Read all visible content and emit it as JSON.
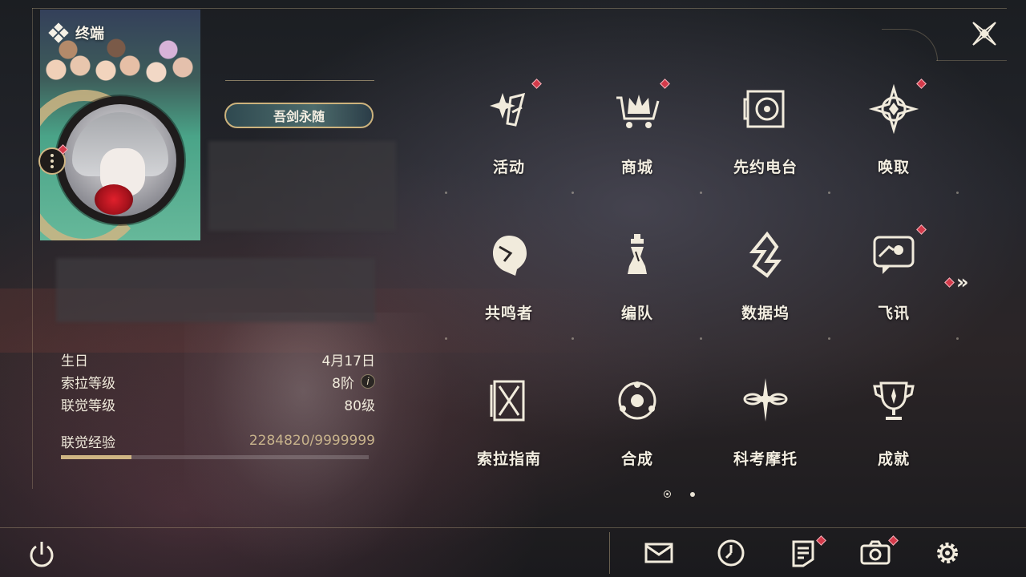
{
  "window": {
    "title": "终端"
  },
  "profile": {
    "title_badge": "吾剑永随"
  },
  "stats": [
    {
      "label": "生日",
      "value": "4月17日"
    },
    {
      "label": "索拉等级",
      "value": "8阶"
    },
    {
      "label": "联觉等级",
      "value": "80级"
    }
  ],
  "experience": {
    "label": "联觉经验",
    "value": "2284820/9999999",
    "progress": 0.2285
  },
  "menu": {
    "items": [
      {
        "label": "活动",
        "icon": "activity-icon",
        "has_notification": true
      },
      {
        "label": "商城",
        "icon": "shop-cart-icon",
        "has_notification": true
      },
      {
        "label": "先约电台",
        "icon": "radio-icon",
        "has_notification": false
      },
      {
        "label": "唤取",
        "icon": "convene-icon",
        "has_notification": true
      },
      {
        "label": "共鸣者",
        "icon": "resonator-icon",
        "has_notification": false
      },
      {
        "label": "编队",
        "icon": "team-chess-icon",
        "has_notification": false
      },
      {
        "label": "数据坞",
        "icon": "data-bank-icon",
        "has_notification": false
      },
      {
        "label": "飞讯",
        "icon": "message-icon",
        "has_notification": true
      },
      {
        "label": "索拉指南",
        "icon": "guidebook-icon",
        "has_notification": false
      },
      {
        "label": "合成",
        "icon": "synthesis-icon",
        "has_notification": false
      },
      {
        "label": "科考摩托",
        "icon": "motorcycle-icon",
        "has_notification": false
      },
      {
        "label": "成就",
        "icon": "trophy-icon",
        "has_notification": false
      }
    ],
    "pagination": {
      "current": 1,
      "total": 2
    }
  },
  "bottom_bar": {
    "buttons": [
      {
        "name": "mail",
        "icon": "mail-icon",
        "has_notification": false
      },
      {
        "name": "clock",
        "icon": "clock-icon",
        "has_notification": false
      },
      {
        "name": "notice",
        "icon": "notice-icon",
        "has_notification": true
      },
      {
        "name": "camera",
        "icon": "camera-icon",
        "has_notification": true
      },
      {
        "name": "settings",
        "icon": "gear-icon",
        "has_notification": false
      }
    ]
  },
  "colors": {
    "accent_gold": "#cfb583",
    "notification_red": "#d43a4a",
    "text": "#f4efe2"
  }
}
